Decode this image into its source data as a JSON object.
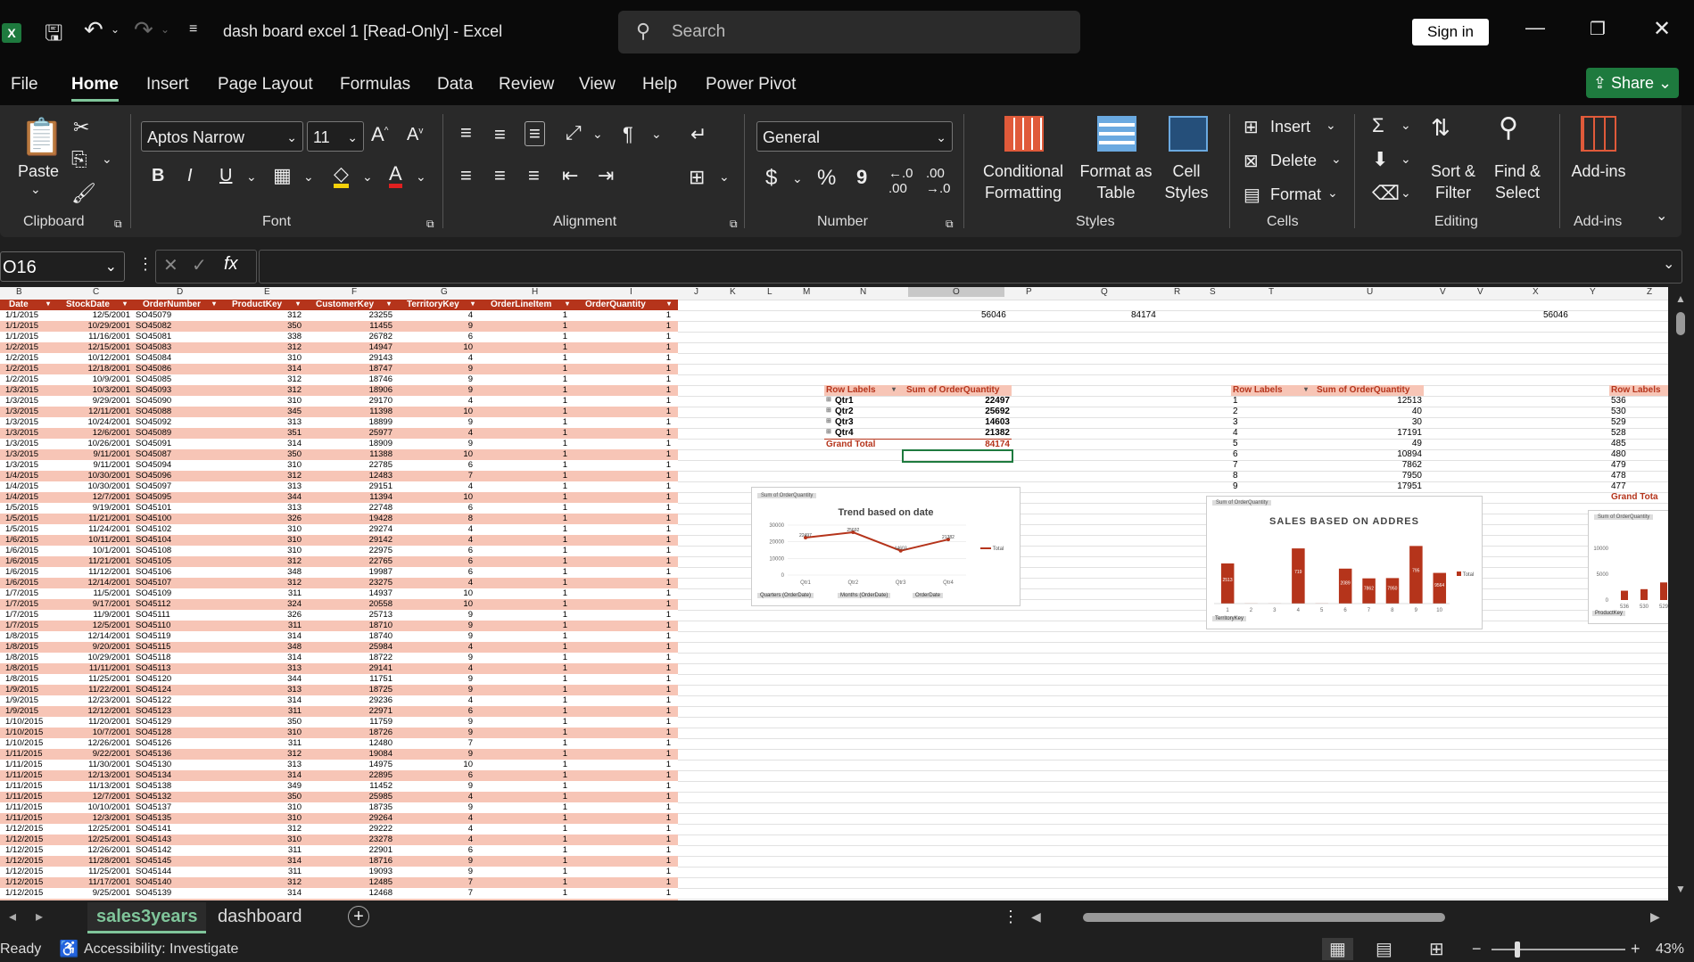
{
  "title": {
    "app_icon": "excel-icon",
    "text": "dash board excel 1  [Read-Only]  -  Excel"
  },
  "search": {
    "placeholder": "Search"
  },
  "account": {
    "signin": "Sign in"
  },
  "menu": [
    "File",
    "Home",
    "Insert",
    "Page Layout",
    "Formulas",
    "Data",
    "Review",
    "View",
    "Help",
    "Power Pivot"
  ],
  "share_label": "Share",
  "ribbon": {
    "clipboard": {
      "paste": "Paste",
      "label": "Clipboard"
    },
    "font": {
      "name": "Aptos Narrow",
      "size": "11",
      "label": "Font",
      "bold": "B",
      "italic": "I",
      "underline": "U"
    },
    "alignment": {
      "label": "Alignment"
    },
    "number": {
      "format": "General",
      "label": "Number",
      "currency": "$",
      "percent": "%",
      "comma": "9"
    },
    "styles": {
      "conditional": "Conditional Formatting",
      "format_table": "Format as Table",
      "cell_styles": "Cell Styles",
      "label": "Styles"
    },
    "cells": {
      "insert": "Insert",
      "delete": "Delete",
      "format": "Format",
      "label": "Cells"
    },
    "editing": {
      "sort": "Sort & Filter",
      "find": "Find & Select",
      "label": "Editing"
    },
    "addins": {
      "addins": "Add-ins",
      "label": "Add-ins"
    }
  },
  "formula_bar": {
    "name_box": "O16",
    "fx": "fx",
    "value": ""
  },
  "columns": [
    "B",
    "C",
    "D",
    "E",
    "F",
    "G",
    "H",
    "I",
    "J",
    "K",
    "L",
    "M",
    "N",
    "O",
    "P",
    "Q",
    "R",
    "S",
    "T",
    "U",
    "V",
    "V",
    "X",
    "Y",
    "Z"
  ],
  "table_headers": [
    "Date",
    "StockDate",
    "OrderNumber",
    "ProductKey",
    "CustomerKey",
    "TerritoryKey",
    "OrderLineItem",
    "OrderQuantity"
  ],
  "rows": [
    [
      "1/1/2015",
      "12/5/2001",
      "SO45079",
      "312",
      "23255",
      "4",
      "1",
      "1"
    ],
    [
      "1/1/2015",
      "10/29/2001",
      "SO45082",
      "350",
      "11455",
      "9",
      "1",
      "1"
    ],
    [
      "1/1/2015",
      "11/16/2001",
      "SO45081",
      "338",
      "26782",
      "6",
      "1",
      "1"
    ],
    [
      "1/2/2015",
      "12/15/2001",
      "SO45083",
      "312",
      "14947",
      "10",
      "1",
      "1"
    ],
    [
      "1/2/2015",
      "10/12/2001",
      "SO45084",
      "310",
      "29143",
      "4",
      "1",
      "1"
    ],
    [
      "1/2/2015",
      "12/18/2001",
      "SO45086",
      "314",
      "18747",
      "9",
      "1",
      "1"
    ],
    [
      "1/2/2015",
      "10/9/2001",
      "SO45085",
      "312",
      "18746",
      "9",
      "1",
      "1"
    ],
    [
      "1/3/2015",
      "10/3/2001",
      "SO45093",
      "312",
      "18906",
      "9",
      "1",
      "1"
    ],
    [
      "1/3/2015",
      "9/29/2001",
      "SO45090",
      "310",
      "29170",
      "4",
      "1",
      "1"
    ],
    [
      "1/3/2015",
      "12/11/2001",
      "SO45088",
      "345",
      "11398",
      "10",
      "1",
      "1"
    ],
    [
      "1/3/2015",
      "10/24/2001",
      "SO45092",
      "313",
      "18899",
      "9",
      "1",
      "1"
    ],
    [
      "1/3/2015",
      "12/6/2001",
      "SO45089",
      "351",
      "25977",
      "4",
      "1",
      "1"
    ],
    [
      "1/3/2015",
      "10/26/2001",
      "SO45091",
      "314",
      "18909",
      "9",
      "1",
      "1"
    ],
    [
      "1/3/2015",
      "9/11/2001",
      "SO45087",
      "350",
      "11388",
      "10",
      "1",
      "1"
    ],
    [
      "1/3/2015",
      "9/11/2001",
      "SO45094",
      "310",
      "22785",
      "6",
      "1",
      "1"
    ],
    [
      "1/4/2015",
      "10/30/2001",
      "SO45096",
      "312",
      "12483",
      "7",
      "1",
      "1"
    ],
    [
      "1/4/2015",
      "10/30/2001",
      "SO45097",
      "313",
      "29151",
      "4",
      "1",
      "1"
    ],
    [
      "1/4/2015",
      "12/7/2001",
      "SO45095",
      "344",
      "11394",
      "10",
      "1",
      "1"
    ],
    [
      "1/5/2015",
      "9/19/2001",
      "SO45101",
      "313",
      "22748",
      "6",
      "1",
      "1"
    ],
    [
      "1/5/2015",
      "11/21/2001",
      "SO45100",
      "326",
      "19428",
      "8",
      "1",
      "1"
    ],
    [
      "1/5/2015",
      "11/24/2001",
      "SO45102",
      "310",
      "29274",
      "4",
      "1",
      "1"
    ],
    [
      "1/6/2015",
      "10/11/2001",
      "SO45104",
      "310",
      "29142",
      "4",
      "1",
      "1"
    ],
    [
      "1/6/2015",
      "10/1/2001",
      "SO45108",
      "310",
      "22975",
      "6",
      "1",
      "1"
    ],
    [
      "1/6/2015",
      "11/21/2001",
      "SO45105",
      "312",
      "22765",
      "6",
      "1",
      "1"
    ],
    [
      "1/6/2015",
      "11/12/2001",
      "SO45106",
      "348",
      "19987",
      "6",
      "1",
      "1"
    ],
    [
      "1/6/2015",
      "12/14/2001",
      "SO45107",
      "312",
      "23275",
      "4",
      "1",
      "1"
    ],
    [
      "1/7/2015",
      "11/5/2001",
      "SO45109",
      "311",
      "14937",
      "10",
      "1",
      "1"
    ],
    [
      "1/7/2015",
      "9/17/2001",
      "SO45112",
      "324",
      "20558",
      "10",
      "1",
      "1"
    ],
    [
      "1/7/2015",
      "11/9/2001",
      "SO45111",
      "326",
      "25713",
      "9",
      "1",
      "1"
    ],
    [
      "1/7/2015",
      "12/5/2001",
      "SO45110",
      "311",
      "18710",
      "9",
      "1",
      "1"
    ],
    [
      "1/8/2015",
      "12/14/2001",
      "SO45119",
      "314",
      "18740",
      "9",
      "1",
      "1"
    ],
    [
      "1/8/2015",
      "9/20/2001",
      "SO45115",
      "348",
      "25984",
      "4",
      "1",
      "1"
    ],
    [
      "1/8/2015",
      "10/29/2001",
      "SO45118",
      "314",
      "18722",
      "9",
      "1",
      "1"
    ],
    [
      "1/8/2015",
      "11/11/2001",
      "SO45113",
      "313",
      "29141",
      "4",
      "1",
      "1"
    ],
    [
      "1/8/2015",
      "11/25/2001",
      "SO45120",
      "344",
      "11751",
      "9",
      "1",
      "1"
    ],
    [
      "1/9/2015",
      "11/22/2001",
      "SO45124",
      "313",
      "18725",
      "9",
      "1",
      "1"
    ],
    [
      "1/9/2015",
      "12/23/2001",
      "SO45122",
      "314",
      "29236",
      "4",
      "1",
      "1"
    ],
    [
      "1/9/2015",
      "12/12/2001",
      "SO45123",
      "311",
      "22971",
      "6",
      "1",
      "1"
    ],
    [
      "1/10/2015",
      "11/20/2001",
      "SO45129",
      "350",
      "11759",
      "9",
      "1",
      "1"
    ],
    [
      "1/10/2015",
      "10/7/2001",
      "SO45128",
      "310",
      "18726",
      "9",
      "1",
      "1"
    ],
    [
      "1/10/2015",
      "12/26/2001",
      "SO45126",
      "311",
      "12480",
      "7",
      "1",
      "1"
    ],
    [
      "1/11/2015",
      "9/22/2001",
      "SO45136",
      "312",
      "19084",
      "9",
      "1",
      "1"
    ],
    [
      "1/11/2015",
      "11/30/2001",
      "SO45130",
      "313",
      "14975",
      "10",
      "1",
      "1"
    ],
    [
      "1/11/2015",
      "12/13/2001",
      "SO45134",
      "314",
      "22895",
      "6",
      "1",
      "1"
    ],
    [
      "1/11/2015",
      "11/13/2001",
      "SO45138",
      "349",
      "11452",
      "9",
      "1",
      "1"
    ],
    [
      "1/11/2015",
      "12/7/2001",
      "SO45132",
      "350",
      "25985",
      "4",
      "1",
      "1"
    ],
    [
      "1/11/2015",
      "10/10/2001",
      "SO45137",
      "310",
      "18735",
      "9",
      "1",
      "1"
    ],
    [
      "1/11/2015",
      "12/3/2001",
      "SO45135",
      "310",
      "29264",
      "4",
      "1",
      "1"
    ],
    [
      "1/12/2015",
      "12/25/2001",
      "SO45141",
      "312",
      "29222",
      "4",
      "1",
      "1"
    ],
    [
      "1/12/2015",
      "12/25/2001",
      "SO45143",
      "310",
      "23278",
      "4",
      "1",
      "1"
    ],
    [
      "1/12/2015",
      "12/26/2001",
      "SO45142",
      "311",
      "22901",
      "6",
      "1",
      "1"
    ],
    [
      "1/12/2015",
      "11/28/2001",
      "SO45145",
      "314",
      "18716",
      "9",
      "1",
      "1"
    ],
    [
      "1/12/2015",
      "11/25/2001",
      "SO45144",
      "311",
      "19093",
      "9",
      "1",
      "1"
    ],
    [
      "1/12/2015",
      "11/17/2001",
      "SO45140",
      "312",
      "12485",
      "7",
      "1",
      "1"
    ],
    [
      "1/12/2015",
      "9/25/2001",
      "SO45139",
      "314",
      "12468",
      "7",
      "1",
      "1"
    ]
  ],
  "top_values": {
    "o": "56046",
    "q": "84174",
    "x": "56046"
  },
  "pivot1": {
    "header_labels": "Row Labels",
    "header_sum": "Sum of OrderQuantity",
    "rows": [
      [
        "Qtr1",
        "22497"
      ],
      [
        "Qtr2",
        "25692"
      ],
      [
        "Qtr3",
        "14603"
      ],
      [
        "Qtr4",
        "21382"
      ]
    ],
    "total_label": "Grand Total",
    "total": "84174"
  },
  "pivot2": {
    "header_labels": "Row Labels",
    "header_sum": "Sum of OrderQuantity",
    "rows": [
      [
        "1",
        "12513"
      ],
      [
        "2",
        "40"
      ],
      [
        "3",
        "30"
      ],
      [
        "4",
        "17191"
      ],
      [
        "5",
        "49"
      ],
      [
        "6",
        "10894"
      ],
      [
        "7",
        "7862"
      ],
      [
        "8",
        "7950"
      ],
      [
        "9",
        "17951"
      ]
    ]
  },
  "pivot3": {
    "header_labels": "Row Labels",
    "rows": [
      "536",
      "530",
      "529",
      "528",
      "485",
      "480",
      "479",
      "478",
      "477"
    ],
    "total_label": "Grand Tota"
  },
  "chart1": {
    "tag": "Sum of OrderQuantity",
    "title": "Trend based on date",
    "legend": "Total",
    "buttons": [
      "Quarters (OrderDate)",
      "Months (OrderDate)",
      "OrderDate"
    ],
    "y_ticks": [
      "30000",
      "20000",
      "10000",
      "0"
    ]
  },
  "chart2": {
    "tag": "Sum of OrderQuantity",
    "title": "SALES BASED ON ADDRES",
    "legend": "Total",
    "button": "TerritoryKey"
  },
  "chart3": {
    "tag": "Sum of OrderQuantity",
    "y_ticks": [
      "10000",
      "5000",
      "0"
    ],
    "button": "ProductKey"
  },
  "chart_data": [
    {
      "type": "line",
      "title": "Trend based on date",
      "categories": [
        "Qtr1",
        "Qtr2",
        "Qtr3",
        "Qtr4"
      ],
      "series": [
        {
          "name": "Total",
          "values": [
            22497,
            25692,
            14603,
            21382
          ]
        }
      ],
      "data_labels": [
        "22497",
        "25692",
        "14603",
        "21382"
      ],
      "ylim": [
        0,
        30000
      ],
      "legend": "right"
    },
    {
      "type": "bar",
      "title": "SALES BASED ON ADDRES",
      "categories": [
        "1",
        "2",
        "3",
        "4",
        "5",
        "6",
        "7",
        "8",
        "9",
        "10"
      ],
      "series": [
        {
          "name": "Total",
          "values": [
            12513,
            40,
            30,
            17191,
            49,
            10894,
            7862,
            7950,
            17951,
            9564
          ]
        }
      ],
      "data_labels": [
        "2513",
        "",
        "",
        "719",
        "",
        "2089",
        "7862",
        "7950",
        "795",
        "9564"
      ],
      "legend": "right"
    },
    {
      "type": "bar",
      "categories": [
        "536",
        "530",
        "529"
      ],
      "values": [
        1800,
        2100,
        3400
      ],
      "ylim": [
        0,
        10000
      ]
    }
  ],
  "sheets": [
    "sales3years",
    "dashboard"
  ],
  "status": {
    "ready": "Ready",
    "accessibility": "Accessibility: Investigate",
    "zoom": "43%"
  }
}
